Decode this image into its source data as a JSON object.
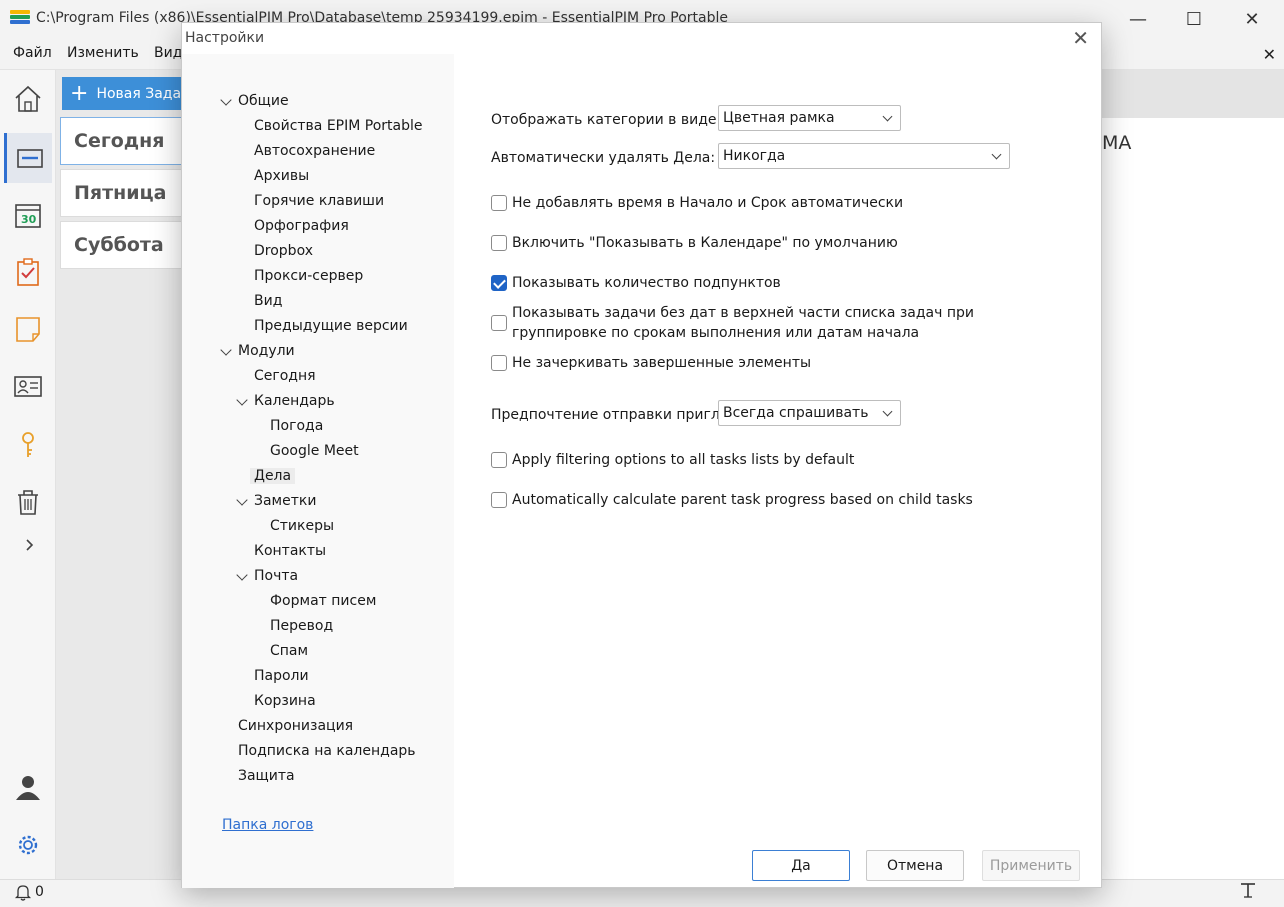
{
  "window": {
    "title": "C:\\Program Files (x86)\\EssentialPIM Pro\\Database\\temp 25934199.epim - EssentialPIM Pro Portable",
    "minimize": "—",
    "maximize": "☐",
    "close": "✕"
  },
  "menu": {
    "items": [
      "Файл",
      "Изменить",
      "Вид"
    ],
    "close": "✕"
  },
  "toolbar": {
    "new_task": "Новая Задача"
  },
  "days": [
    "Сегодня",
    "Пятница",
    "Суббота"
  ],
  "right_pane_text": "МА",
  "status": {
    "notifications_count": "0"
  },
  "dialog": {
    "title": "Настройки",
    "close": "✕",
    "tree": [
      {
        "label": "Общие",
        "level": 0,
        "expanded": true
      },
      {
        "label": "Свойства EPIM Portable",
        "level": 1
      },
      {
        "label": "Автосохранение",
        "level": 1
      },
      {
        "label": "Архивы",
        "level": 1
      },
      {
        "label": "Горячие клавиши",
        "level": 1
      },
      {
        "label": "Орфография",
        "level": 1
      },
      {
        "label": "Dropbox",
        "level": 1
      },
      {
        "label": "Прокси-сервер",
        "level": 1
      },
      {
        "label": "Вид",
        "level": 1
      },
      {
        "label": "Предыдущие версии",
        "level": 1
      },
      {
        "label": "Модули",
        "level": 0,
        "expanded": true
      },
      {
        "label": "Сегодня",
        "level": 1
      },
      {
        "label": "Календарь",
        "level": 1,
        "expanded": true
      },
      {
        "label": "Погода",
        "level": 2
      },
      {
        "label": "Google Meet",
        "level": 2
      },
      {
        "label": "Дела",
        "level": 1,
        "selected": true
      },
      {
        "label": "Заметки",
        "level": 1,
        "expanded": true
      },
      {
        "label": "Стикеры",
        "level": 2
      },
      {
        "label": "Контакты",
        "level": 1
      },
      {
        "label": "Почта",
        "level": 1,
        "expanded": true
      },
      {
        "label": "Формат писем",
        "level": 2
      },
      {
        "label": "Перевод",
        "level": 2
      },
      {
        "label": "Спам",
        "level": 2
      },
      {
        "label": "Пароли",
        "level": 1
      },
      {
        "label": "Корзина",
        "level": 1
      },
      {
        "label": "Синхронизация",
        "level": 0
      },
      {
        "label": "Подписка на календарь",
        "level": 0
      },
      {
        "label": "Защита",
        "level": 0
      }
    ],
    "log_folder_link": "Папка логов",
    "settings": {
      "categories_label": "Отображать категории в виде:",
      "categories_value": "Цветная рамка",
      "autodelete_label": "Автоматически удалять Дела:",
      "autodelete_value": "Никогда",
      "invite_label": "Предпочтение отправки пригла",
      "invite_value": "Всегда спрашивать"
    },
    "checkboxes": [
      {
        "label": "Не добавлять время в Начало и Срок автоматически",
        "checked": false
      },
      {
        "label": "Включить \"Показывать в Календаре\" по умолчанию",
        "checked": false
      },
      {
        "label": "Показывать количество подпунктов",
        "checked": true
      },
      {
        "label": "Показывать задачи без дат в верхней части списка задач при группировке по срокам выполнения или датам начала",
        "checked": false
      },
      {
        "label": "Не зачеркивать завершенные элементы",
        "checked": false
      },
      {
        "label": "Apply filtering options to all tasks lists by default",
        "checked": false
      },
      {
        "label": "Automatically calculate parent task progress based on child tasks",
        "checked": false
      }
    ],
    "buttons": {
      "ok": "Да",
      "cancel": "Отмена",
      "apply": "Применить"
    }
  },
  "colors": {
    "accent": "#1f64c6",
    "new_task_button": "#3d8fd8",
    "link": "#2f6fd0"
  }
}
